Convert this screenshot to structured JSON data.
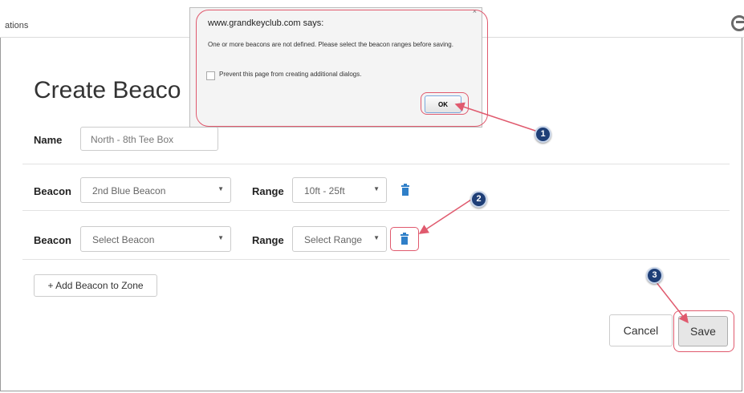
{
  "topbar": {
    "partial_label": "ations",
    "user_icon": "user-circle-icon"
  },
  "page": {
    "title": "Create Beaco",
    "name_label": "Name",
    "name_value": "North - 8th Tee Box",
    "rows": [
      {
        "beacon_label": "Beacon",
        "beacon_value": "2nd Blue Beacon",
        "range_label": "Range",
        "range_value": "10ft - 25ft"
      },
      {
        "beacon_label": "Beacon",
        "beacon_value": "Select Beacon",
        "range_label": "Range",
        "range_value": "Select Range"
      }
    ],
    "caret": "▼",
    "add_button": "+ Add Beacon to Zone",
    "cancel_button": "Cancel",
    "save_button": "Save"
  },
  "dialog": {
    "title": "www.grandkeyclub.com says:",
    "message": "One or more beacons are not defined. Please select the beacon ranges before saving.",
    "prevent_label": "Prevent this page from creating additional dialogs.",
    "ok_button": "OK",
    "close": "×"
  },
  "annotations": {
    "badge1": "1",
    "badge2": "2",
    "badge3": "3"
  },
  "colors": {
    "highlight": "#e05a6e",
    "badge": "#1f3f77",
    "trash": "#2f7fc8"
  }
}
